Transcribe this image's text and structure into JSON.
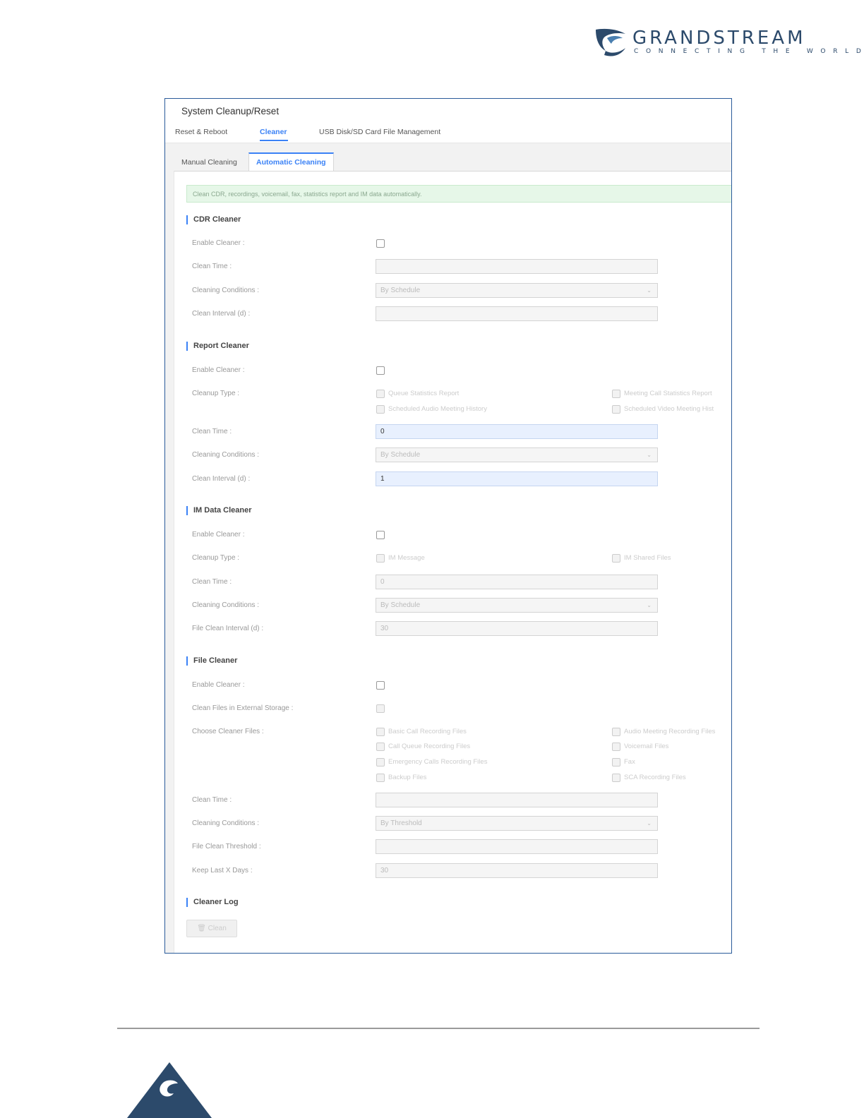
{
  "brand": {
    "name": "GRANDSTREAM",
    "tagline": "CONNECTING THE WORLD"
  },
  "window": {
    "title": "System Cleanup/Reset"
  },
  "main_tabs": [
    {
      "label": "Reset & Reboot"
    },
    {
      "label": "Cleaner"
    },
    {
      "label": "USB Disk/SD Card File Management"
    }
  ],
  "sub_tabs": [
    {
      "label": "Manual Cleaning"
    },
    {
      "label": "Automatic Cleaning"
    }
  ],
  "notice": "Clean CDR, recordings, voicemail, fax, statistics report and IM data automatically.",
  "cdr": {
    "title": "CDR Cleaner",
    "enable_label": "Enable Cleaner :",
    "clean_time_label": "Clean Time :",
    "conditions_label": "Cleaning Conditions :",
    "conditions_value": "By Schedule",
    "interval_label": "Clean Interval (d) :"
  },
  "report": {
    "title": "Report Cleaner",
    "enable_label": "Enable Cleaner :",
    "type_label": "Cleanup Type :",
    "types": [
      "Queue Statistics Report",
      "Meeting Call Statistics Report",
      "Scheduled Audio Meeting History",
      "Scheduled Video Meeting Hist"
    ],
    "clean_time_label": "Clean Time :",
    "clean_time_value": "0",
    "conditions_label": "Cleaning Conditions :",
    "conditions_value": "By Schedule",
    "interval_label": "Clean Interval (d) :",
    "interval_value": "1"
  },
  "im": {
    "title": "IM Data Cleaner",
    "enable_label": "Enable Cleaner :",
    "type_label": "Cleanup Type :",
    "types": [
      "IM Message",
      "IM Shared Files"
    ],
    "clean_time_label": "Clean Time :",
    "clean_time_value": "0",
    "conditions_label": "Cleaning Conditions :",
    "conditions_value": "By Schedule",
    "interval_label": "File Clean Interval (d) :",
    "interval_value": "30"
  },
  "file": {
    "title": "File Cleaner",
    "enable_label": "Enable Cleaner :",
    "external_label": "Clean Files in External Storage :",
    "choose_label": "Choose Cleaner Files :",
    "files": [
      "Basic Call Recording Files",
      "Audio Meeting Recording Files",
      "Call Queue Recording Files",
      "Voicemail Files",
      "Emergency Calls Recording Files",
      "Fax",
      "Backup Files",
      "SCA Recording Files"
    ],
    "clean_time_label": "Clean Time :",
    "conditions_label": "Cleaning Conditions :",
    "conditions_value": "By Threshold",
    "threshold_label": "File Clean Threshold :",
    "keep_label": "Keep Last X Days :",
    "keep_value": "30"
  },
  "log": {
    "title": "Cleaner Log",
    "clean_button": "Clean"
  }
}
